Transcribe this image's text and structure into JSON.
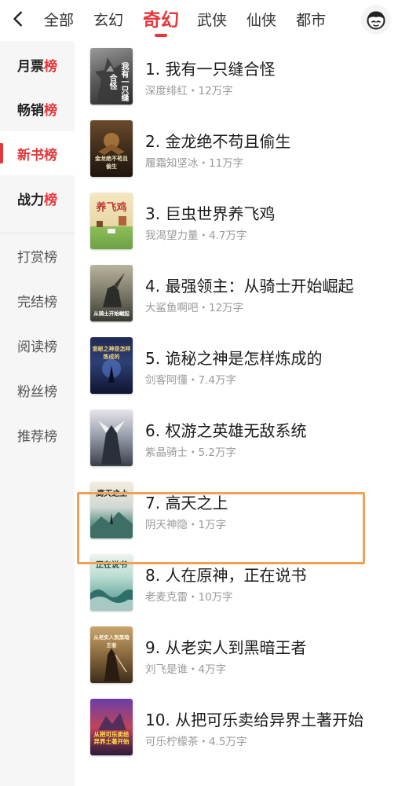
{
  "nav": {
    "tabs": [
      {
        "label": "全部"
      },
      {
        "label": "玄幻"
      },
      {
        "label": "奇幻"
      },
      {
        "label": "武侠"
      },
      {
        "label": "仙侠"
      },
      {
        "label": "都市"
      }
    ],
    "active_tab": "奇幻"
  },
  "sidebar": {
    "items": [
      {
        "label_main": "月票",
        "label_last": "榜"
      },
      {
        "label_main": "畅销",
        "label_last": "榜"
      },
      {
        "label_main": "新书",
        "label_last": "榜"
      },
      {
        "label_main": "战力",
        "label_last": "榜"
      },
      {
        "label": "打赏榜"
      },
      {
        "label": "完结榜"
      },
      {
        "label": "阅读榜"
      },
      {
        "label": "粉丝榜"
      },
      {
        "label": "推荐榜"
      }
    ],
    "selected": "新书榜"
  },
  "books": [
    {
      "title": "1. 我有一只缝合怪",
      "meta": "深度绯红・12万字",
      "cover_text": "我有一只缝合怪"
    },
    {
      "title": "2. 金龙绝不苟且偷生",
      "meta": "履霜知坚冰・11万字",
      "cover_text": "金龙绝不苟且偷生"
    },
    {
      "title": "3. 巨虫世界养飞鸡",
      "meta": "我渴望力量・4.7万字",
      "cover_text": "养飞鸡"
    },
    {
      "title": "4. 最强领主：从骑士开始崛起",
      "meta": "大鲨鱼啊吧・12万字",
      "cover_text": "从骑士开始崛起"
    },
    {
      "title": "5. 诡秘之神是怎样炼成的",
      "meta": "剑客阿懂・7.4万字",
      "cover_text": "诡秘之神是怎样炼成的"
    },
    {
      "title": "6. 权游之英雄无敌系统",
      "meta": "紫晶骑士・5.2万字",
      "cover_text": ""
    },
    {
      "title": "7. 高天之上",
      "meta": "阴天神隐・1万字",
      "cover_text": "高天之上"
    },
    {
      "title": "8. 人在原神，正在说书",
      "meta": "老麦克雷・10万字",
      "cover_text": "正在说书"
    },
    {
      "title": "9. 从老实人到黑暗王者",
      "meta": "刘飞是谁・4万字",
      "cover_text": "从老实人到黑暗王者"
    },
    {
      "title": "10. 从把可乐卖给异界土著开始",
      "meta": "可乐柠檬茶・4.5万字",
      "cover_text": "从把可乐卖给异界土著开始"
    }
  ],
  "highlighted_book": "7. 高天之上",
  "colors": {
    "accent": "#e5383b",
    "highlight_border": "#f0a155",
    "sidebar_bg": "#f6f6f6",
    "meta_text": "#999999"
  },
  "icons": {
    "back": "chevron-left-icon",
    "avatar": "user-avatar-icon"
  }
}
